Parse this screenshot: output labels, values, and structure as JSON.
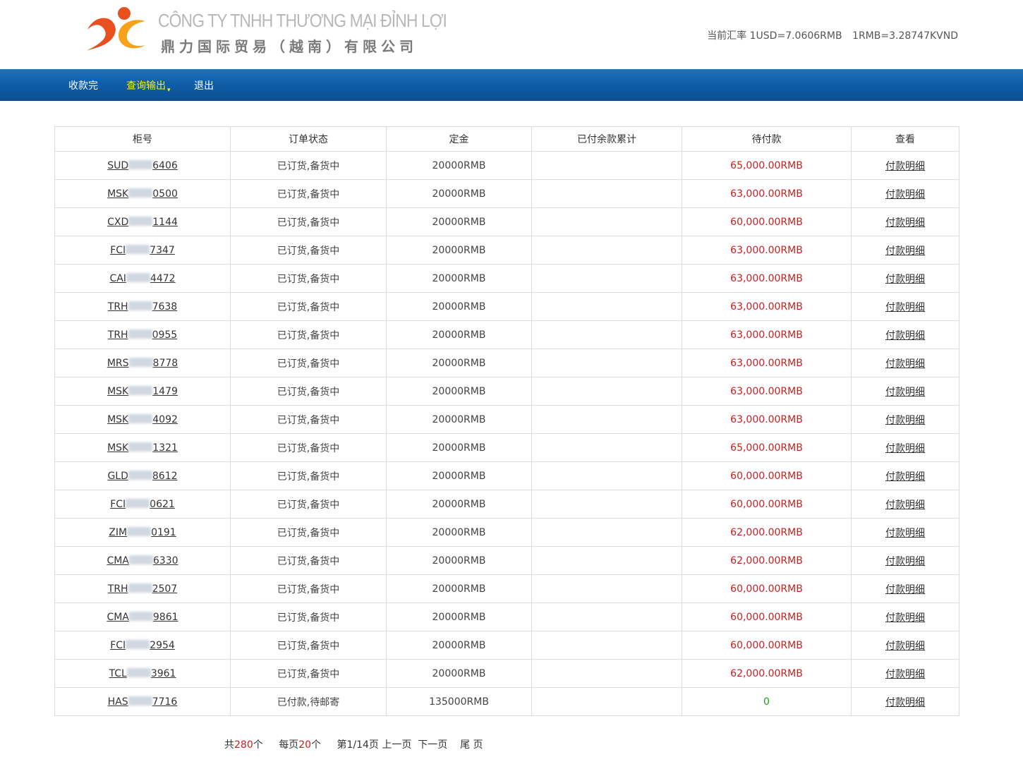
{
  "header": {
    "company_vn": "CÔNG TY TNHH THƯƠNG MẠI ĐỈNH LỢI",
    "company_cn": "鼎力国际贸易（越南）有限公司",
    "rate_label": "当前汇率",
    "rate_usd": "1USD=7.0606RMB",
    "rate_vnd": "1RMB=3.28747KVND"
  },
  "nav": {
    "items": [
      {
        "label": "收款完"
      },
      {
        "label": "查询输出"
      },
      {
        "label": "退出"
      }
    ]
  },
  "colors": {
    "nav_blue": "#0f5ea9",
    "active_nav": "#f5f500",
    "amount_red": "#cc1f1f",
    "amount_green": "#1aa31a"
  },
  "table": {
    "headers": [
      "柜号",
      "订单状态",
      "定金",
      "已付余款累计",
      "待付款",
      "查看"
    ],
    "rows": [
      {
        "prefix": "SUD",
        "suffix": "6406",
        "status": "已订货,备货中",
        "deposit": "20000RMB",
        "paid": "",
        "due": "65,000.00RMB",
        "link": "付款明细"
      },
      {
        "prefix": "MSK",
        "suffix": "0500",
        "status": "已订货,备货中",
        "deposit": "20000RMB",
        "paid": "",
        "due": "63,000.00RMB",
        "link": "付款明细"
      },
      {
        "prefix": "CXD",
        "suffix": "1144",
        "status": "已订货,备货中",
        "deposit": "20000RMB",
        "paid": "",
        "due": "60,000.00RMB",
        "link": "付款明细"
      },
      {
        "prefix": "FCI",
        "suffix": "7347",
        "status": "已订货,备货中",
        "deposit": "20000RMB",
        "paid": "",
        "due": "63,000.00RMB",
        "link": "付款明细"
      },
      {
        "prefix": "CAI",
        "suffix": "4472",
        "status": "已订货,备货中",
        "deposit": "20000RMB",
        "paid": "",
        "due": "63,000.00RMB",
        "link": "付款明细"
      },
      {
        "prefix": "TRH",
        "suffix": "7638",
        "status": "已订货,备货中",
        "deposit": "20000RMB",
        "paid": "",
        "due": "63,000.00RMB",
        "link": "付款明细"
      },
      {
        "prefix": "TRH",
        "suffix": "0955",
        "status": "已订货,备货中",
        "deposit": "20000RMB",
        "paid": "",
        "due": "63,000.00RMB",
        "link": "付款明细"
      },
      {
        "prefix": "MRS",
        "suffix": "8778",
        "status": "已订货,备货中",
        "deposit": "20000RMB",
        "paid": "",
        "due": "63,000.00RMB",
        "link": "付款明细"
      },
      {
        "prefix": "MSK",
        "suffix": "1479",
        "status": "已订货,备货中",
        "deposit": "20000RMB",
        "paid": "",
        "due": "63,000.00RMB",
        "link": "付款明细"
      },
      {
        "prefix": "MSK",
        "suffix": "4092",
        "status": "已订货,备货中",
        "deposit": "20000RMB",
        "paid": "",
        "due": "63,000.00RMB",
        "link": "付款明细"
      },
      {
        "prefix": "MSK",
        "suffix": "1321",
        "status": "已订货,备货中",
        "deposit": "20000RMB",
        "paid": "",
        "due": "65,000.00RMB",
        "link": "付款明细"
      },
      {
        "prefix": "GLD",
        "suffix": "8612",
        "status": "已订货,备货中",
        "deposit": "20000RMB",
        "paid": "",
        "due": "60,000.00RMB",
        "link": "付款明细"
      },
      {
        "prefix": "FCI",
        "suffix": "0621",
        "status": "已订货,备货中",
        "deposit": "20000RMB",
        "paid": "",
        "due": "60,000.00RMB",
        "link": "付款明细"
      },
      {
        "prefix": "ZIM",
        "suffix": "0191",
        "status": "已订货,备货中",
        "deposit": "20000RMB",
        "paid": "",
        "due": "62,000.00RMB",
        "link": "付款明细"
      },
      {
        "prefix": "CMA",
        "suffix": "6330",
        "status": "已订货,备货中",
        "deposit": "20000RMB",
        "paid": "",
        "due": "62,000.00RMB",
        "link": "付款明细"
      },
      {
        "prefix": "TRH",
        "suffix": "2507",
        "status": "已订货,备货中",
        "deposit": "20000RMB",
        "paid": "",
        "due": "60,000.00RMB",
        "link": "付款明细"
      },
      {
        "prefix": "CMA",
        "suffix": "9861",
        "status": "已订货,备货中",
        "deposit": "20000RMB",
        "paid": "",
        "due": "60,000.00RMB",
        "link": "付款明细"
      },
      {
        "prefix": "FCI",
        "suffix": "2954",
        "status": "已订货,备货中",
        "deposit": "20000RMB",
        "paid": "",
        "due": "60,000.00RMB",
        "link": "付款明细"
      },
      {
        "prefix": "TCL",
        "suffix": "3961",
        "status": "已订货,备货中",
        "deposit": "20000RMB",
        "paid": "",
        "due": "62,000.00RMB",
        "link": "付款明细"
      },
      {
        "prefix": "HAS",
        "suffix": "7716",
        "status": "已付款,待邮寄",
        "deposit": "135000RMB",
        "paid": "",
        "due": "0",
        "link": "付款明细"
      }
    ]
  },
  "pager": {
    "total_pre": "共",
    "total": "280",
    "total_post": "个",
    "per_pre": "每页",
    "per": "20",
    "per_post": "个",
    "page": "第1/14页",
    "prev": "上一页",
    "next": "下一页",
    "last": "尾 页"
  }
}
